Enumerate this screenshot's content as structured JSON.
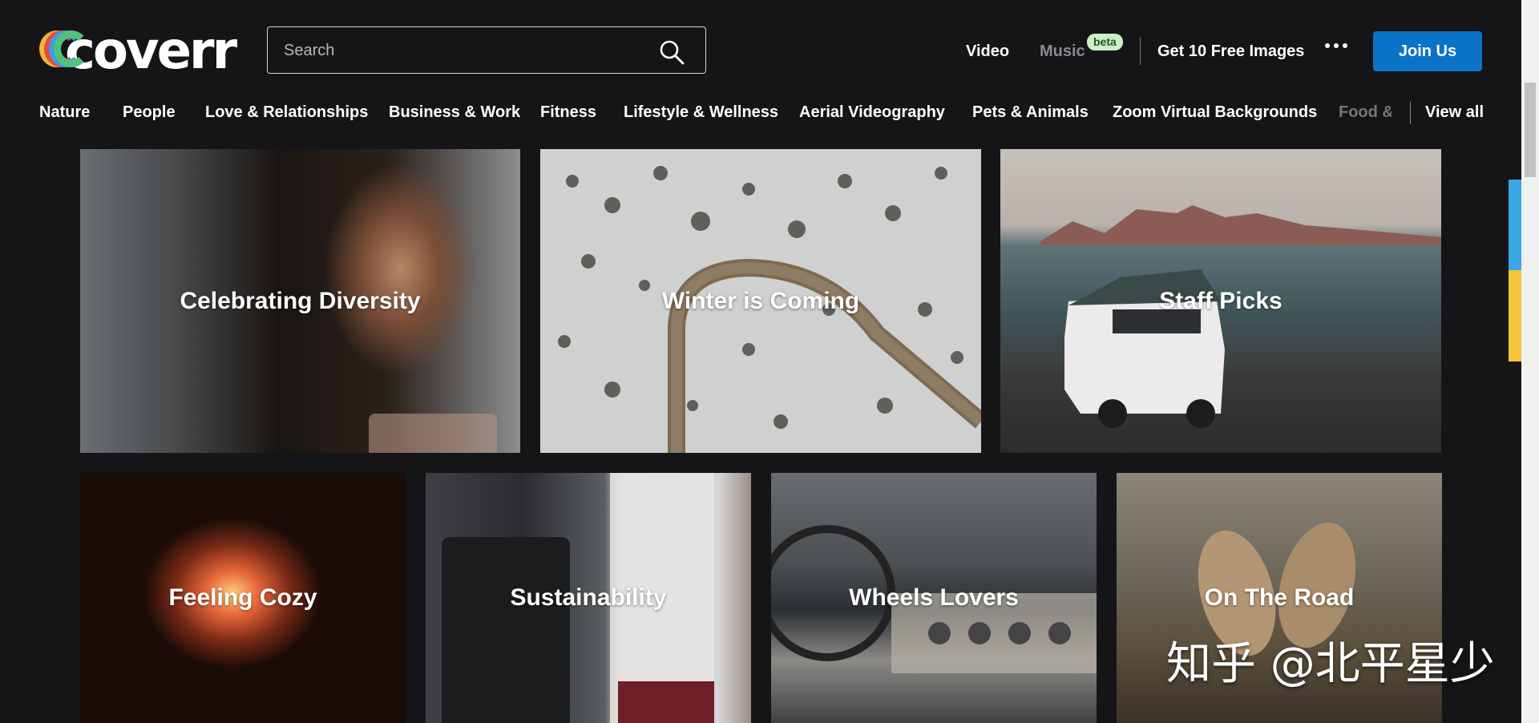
{
  "brand": {
    "name": "coverr"
  },
  "search": {
    "placeholder": "Search"
  },
  "header_nav": {
    "video": "Video",
    "music": "Music",
    "music_badge": "beta",
    "free_images": "Get 10 Free Images",
    "join": "Join Us"
  },
  "categories": [
    "Nature",
    "People",
    "Love & Relationships",
    "Business & Work",
    "Fitness",
    "Lifestyle & Wellness",
    "Aerial Videography",
    "Pets & Animals",
    "Zoom Virtual Backgrounds",
    "Food &"
  ],
  "view_all": "View all",
  "collections": [
    {
      "title": "Celebrating Diversity"
    },
    {
      "title": "Winter is Coming"
    },
    {
      "title": "Staff Picks"
    },
    {
      "title": "Feeling Cozy"
    },
    {
      "title": "Sustainability"
    },
    {
      "title": "Wheels Lovers"
    },
    {
      "title": "On The Road"
    }
  ],
  "watermark": "知乎 @北平星少",
  "colors": {
    "background": "#151518",
    "accent": "#0a73c8",
    "beta_badge": "#cdeec8"
  }
}
